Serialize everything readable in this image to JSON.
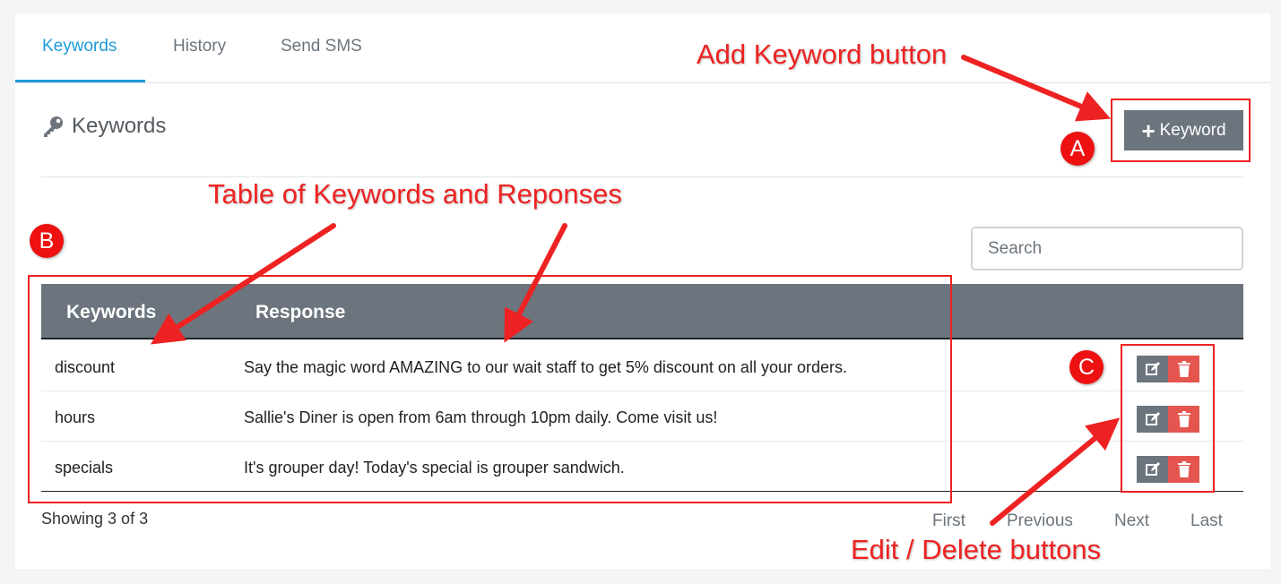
{
  "tabs": [
    {
      "label": "Keywords",
      "active": true
    },
    {
      "label": "History",
      "active": false
    },
    {
      "label": "Send SMS",
      "active": false
    }
  ],
  "section": {
    "title": "Keywords",
    "icon": "key-icon"
  },
  "add_button": {
    "plus": "+",
    "label": "Keyword"
  },
  "search": {
    "placeholder": "Search",
    "value": ""
  },
  "table": {
    "columns": [
      "Keywords",
      "Response"
    ],
    "rows": [
      {
        "keyword": "discount",
        "response": "Say the magic word AMAZING to our wait staff to get 5% discount on all your orders."
      },
      {
        "keyword": "hours",
        "response": "Sallie's Diner is open from 6am through 10pm daily. Come visit us!"
      },
      {
        "keyword": "specials",
        "response": "It's grouper day! Today's special is grouper sandwich."
      }
    ]
  },
  "footer": {
    "showing": "Showing 3 of 3",
    "pagination": [
      "First",
      "Previous",
      "Next",
      "Last"
    ]
  },
  "annotations": {
    "add_keyword": "Add Keyword button",
    "table": "Table of Keywords and Reponses",
    "edit_delete": "Edit / Delete buttons",
    "marker_a": "A",
    "marker_b": "B",
    "marker_c": "C"
  },
  "colors": {
    "accent": "#1d9bd9",
    "header_gray": "#6c757d",
    "delete_red": "#e5554f",
    "annotation_red": "#ee2222"
  }
}
